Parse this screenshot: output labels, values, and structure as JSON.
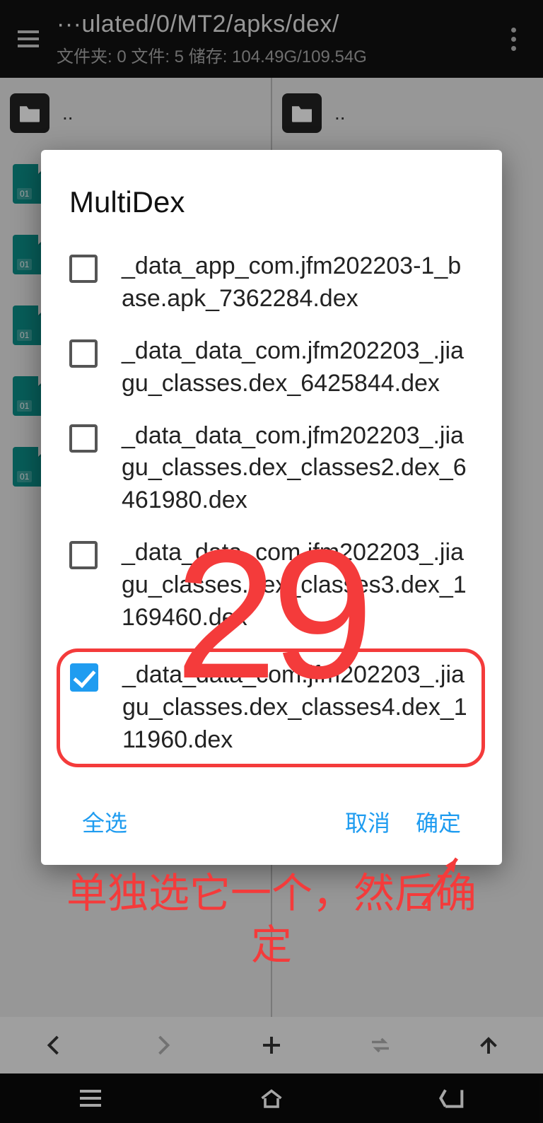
{
  "appbar": {
    "title": "···ulated/0/MT2/apks/dex/",
    "subtitle": "文件夹: 0  文件: 5  储存: 104.49G/109.54G"
  },
  "left_pane": {
    "parent_label": "..",
    "rows": [
      "",
      "",
      "",
      "",
      ""
    ]
  },
  "right_pane": {
    "parent_label": ".."
  },
  "dialog": {
    "title": "MultiDex",
    "items": [
      {
        "checked": false,
        "label": "_data_app_com.jfm202203-1_base.apk_7362284.dex"
      },
      {
        "checked": false,
        "label": "_data_data_com.jfm202203_.jiagu_classes.dex_6425844.dex"
      },
      {
        "checked": false,
        "label": "_data_data_com.jfm202203_.jiagu_classes.dex_classes2.dex_6461980.dex"
      },
      {
        "checked": false,
        "label": "_data_data_com.jfm202203_.jiagu_classes.dex_classes3.dex_1169460.dex"
      },
      {
        "checked": true,
        "label": "_data_data_com.jfm202203_.jiagu_classes.dex_classes4.dex_111960.dex"
      }
    ],
    "actions": {
      "select_all": "全选",
      "cancel": "取消",
      "ok": "确定"
    }
  },
  "annotations": {
    "number": "29",
    "text_line1": "单独选它一个，然后确",
    "text_line2": "定"
  }
}
